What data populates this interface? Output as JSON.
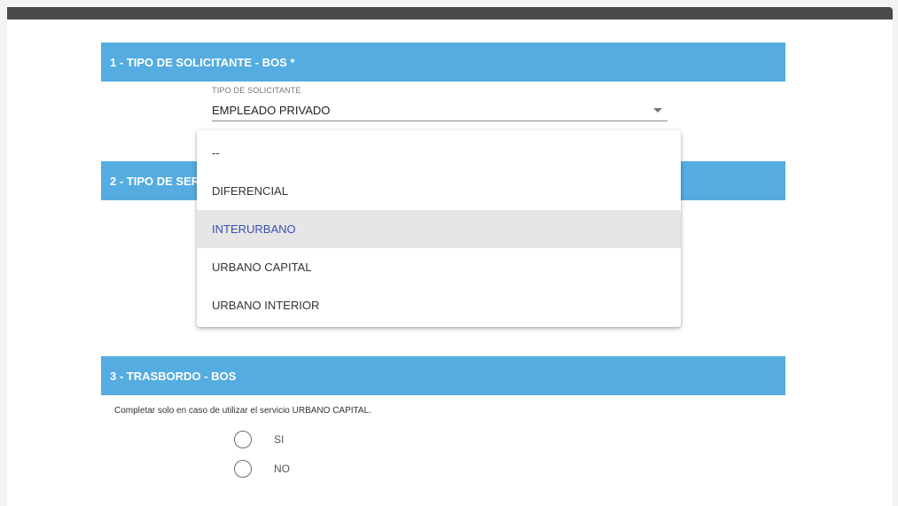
{
  "sections": {
    "s1": {
      "title": "1 - TIPO DE SOLICITANTE - BOS *"
    },
    "s2": {
      "title": "2 - TIPO DE SERVICIO - BOS *"
    },
    "s3": {
      "title": "3 - TRASBORDO - BOS"
    }
  },
  "solicitante": {
    "label": "TIPO DE SOLICITANTE",
    "value": "EMPLEADO PRIVADO"
  },
  "servicio_dropdown": {
    "options": [
      "--",
      "DIFERENCIAL",
      "INTERURBANO",
      "URBANO CAPITAL",
      "URBANO INTERIOR"
    ],
    "highlighted": "INTERURBANO"
  },
  "trasbordo": {
    "helper_text": "Completar solo en caso de utilizar el servicio URBANO CAPITAL.",
    "options": [
      "SI",
      "NO"
    ]
  },
  "colors": {
    "header_bg": "#55ace0",
    "topbar": "#4a4a4a",
    "highlight_text": "#3d4fb5"
  }
}
